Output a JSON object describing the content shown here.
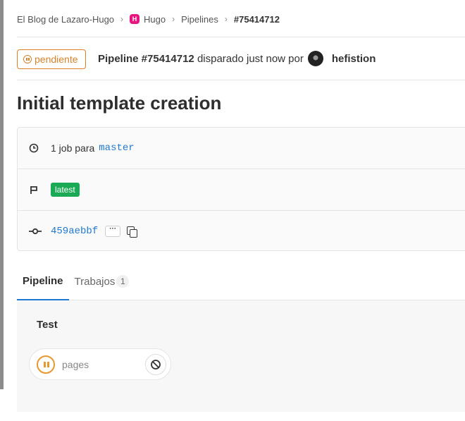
{
  "breadcrumb": {
    "items": [
      "El Blog de Lazaro-Hugo",
      "Hugo",
      "Pipelines",
      "#75414712"
    ],
    "project_avatar_letter": "H"
  },
  "header": {
    "status": "pendiente",
    "pipeline_label": "Pipeline #75414712",
    "triggered_text": "disparado just now por",
    "user": "hefistion"
  },
  "title": "Initial template creation",
  "info": {
    "jobs_text": "1 job para",
    "branch": "master",
    "latest_badge": "latest",
    "commit_sha": "459aebbf",
    "ellipsis": "···"
  },
  "tabs": [
    {
      "label": "Pipeline",
      "active": true
    },
    {
      "label": "Trabajos",
      "count": "1",
      "active": false
    }
  ],
  "pipeline": {
    "stage": "Test",
    "job": {
      "name": "pages",
      "status": "pending"
    }
  },
  "colors": {
    "pending": "#d9822b",
    "link": "#1f78d1",
    "success_badge": "#1aaa55",
    "hugo_brand": "#e6157f"
  }
}
